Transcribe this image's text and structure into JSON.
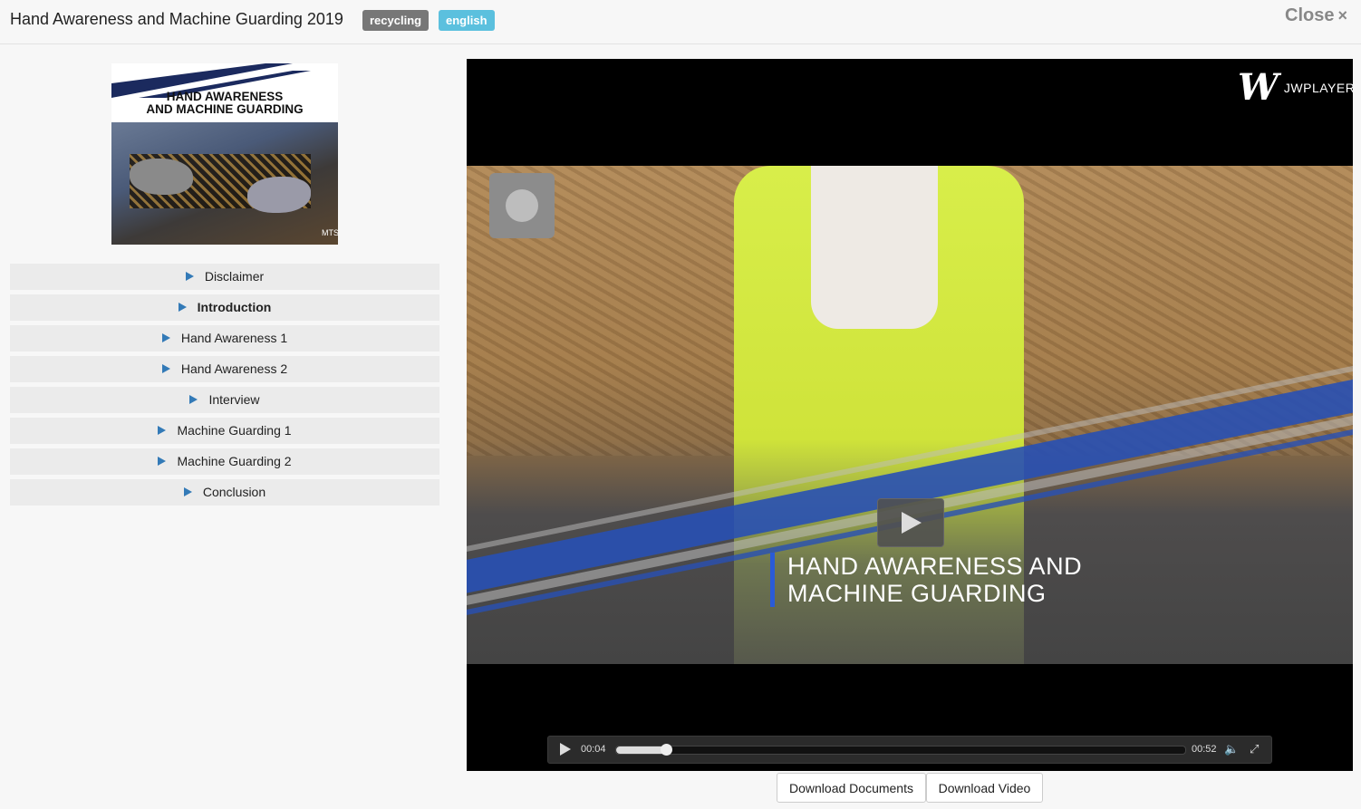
{
  "modal": {
    "title": "Hand Awareness and Machine Guarding 2019",
    "tags": [
      "recycling",
      "english"
    ],
    "close_label": "Close",
    "close_glyph": "×"
  },
  "thumbnail": {
    "title_line1": "HAND AWARENESS",
    "title_line2": "AND MACHINE GUARDING",
    "logo_text": "MTS"
  },
  "chapters": [
    {
      "label": "Disclaimer",
      "active": false
    },
    {
      "label": "Introduction",
      "active": true
    },
    {
      "label": "Hand Awareness 1",
      "active": false
    },
    {
      "label": "Hand Awareness 2",
      "active": false
    },
    {
      "label": "Interview",
      "active": false
    },
    {
      "label": "Machine Guarding 1",
      "active": false
    },
    {
      "label": "Machine Guarding 2",
      "active": false
    },
    {
      "label": "Conclusion",
      "active": false
    }
  ],
  "player": {
    "brand_mark": "W",
    "brand_text": "JWPLAYER",
    "video_title_line1": "HAND AWARENESS AND",
    "video_title_line2": "MACHINE GUARDING",
    "current_time": "00:04",
    "duration": "00:52",
    "progress_fraction": 0.087,
    "volume_icon": "🔈",
    "fullscreen_icon": "⤢"
  },
  "actions": {
    "download_documents": "Download Documents",
    "download_video": "Download Video"
  },
  "colors": {
    "accent": "#337ab7",
    "tag_gray": "#777777",
    "tag_blue": "#5bc0de",
    "chapter_bg": "#ebebeb",
    "title_rule": "#2a5bd7"
  }
}
